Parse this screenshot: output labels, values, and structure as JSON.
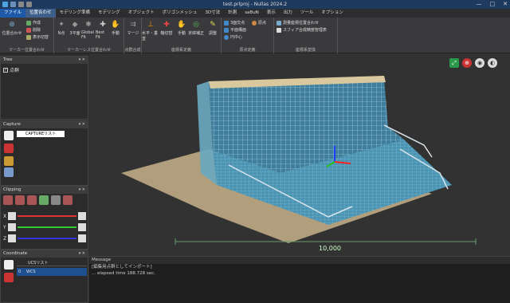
{
  "window": {
    "title": "test.prlproj - Nullas 2024.2",
    "min": "—",
    "max": "□",
    "close": "✕"
  },
  "menu": [
    "ファイル",
    "位置合わせ",
    "モデリング準備",
    "モデリング",
    "オブジェクト",
    "ポリゴンメッシュ",
    "3D寸法",
    "計測",
    "saBuN",
    "表示",
    "出力",
    "ツール",
    "オプション"
  ],
  "ribbon": {
    "g1": {
      "big": "位置合わせ",
      "small": [
        "作成",
        "削除",
        "表示切替"
      ],
      "label": "マーカー位置合わせ"
    },
    "g2": {
      "btns": [
        "N点",
        "3平面",
        "Global Fit",
        "Best Fit",
        "手動"
      ],
      "label": "マーカーレス位置合わせ"
    },
    "g3": {
      "btns": [
        "マージ"
      ],
      "label": "点群合成"
    },
    "g4": {
      "btns": [
        "水平・垂直",
        "軸切替",
        "手動",
        "京緯補正",
        "調整"
      ],
      "label": "座標系定義"
    },
    "g5": {
      "small": [
        "3面交点",
        "平面構面",
        "円中心",
        "原点"
      ],
      "label": "原点定義"
    },
    "g6": {
      "small": [
        "測量座標位置合わせ",
        "スフィア合成精度管理表"
      ],
      "label": "座標系変換"
    }
  },
  "panels": {
    "tree": {
      "title": "Tree",
      "item": "点群"
    },
    "capture": {
      "title": "Capture",
      "tab": "CAPTUREリスト"
    },
    "clipping": {
      "title": "Clipping",
      "axes": [
        "X",
        "Y",
        "Z"
      ]
    },
    "coordinate": {
      "title": "Coordinate",
      "header": "UCSリスト",
      "row_index": "0",
      "row_name": "WCS"
    }
  },
  "viewport": {
    "scale_label": "10,000"
  },
  "message": {
    "title": "Message",
    "lines": [
      "[編集用点群としてインポート]",
      "... elapsed time 188.728 sec."
    ]
  },
  "colors": {
    "accent": "#1e5aa8",
    "pointcloud": "#5fb8d8",
    "ground": "#c8b28a"
  }
}
